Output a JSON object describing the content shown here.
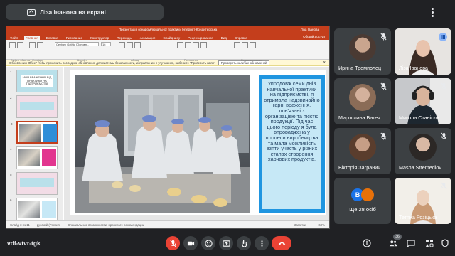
{
  "header": {
    "presenting_text": "Ліза Іванова на екрані"
  },
  "powerpoint": {
    "title": "Презентація ознайомлювальної практики Інтернет-Кондитерська",
    "user": "Ліза Іванова",
    "tabs": [
      "Файл",
      "Главная",
      "Вставка",
      "Рисование",
      "Конструктор",
      "Переходы",
      "Анимация",
      "Слайд-шоу",
      "Рецензирование",
      "Вид",
      "Справка"
    ],
    "active_tab": "Главная",
    "share_label": "Общий доступ",
    "font_name": "Century Gothic (Основн...",
    "font_size": "16",
    "ribbon_groups": [
      "Буфер обмена",
      "Слайды",
      "Шрифт",
      "Абзац",
      "Рисование",
      "Редактирование"
    ],
    "message_bar": "Обновления Office  Чтобы применить последние обновления для системы безопасности, исправления и улучшения, выберите \"Проверить наличие обновлений\".",
    "message_button": "Проверить наличие обновлений",
    "slide_numbers": [
      "1",
      "2",
      "3",
      "4",
      "5",
      "6"
    ],
    "thumb1_text": "МОЯ ВРАЖЕННЯ ВІД ПРАКТИКИ НА ПІДПРИЄМСТВІ",
    "slide_text": "Упродовж семи днів навчальної практики на підприємстві, я отримала надзвичайно гарні враження, пов'язані з організацією та якістю продукції. Під час цього періоду я була впроваджена у процеси виробництва та мала можливість взяти участь у різних етапах створення харчових продуктів.",
    "status_left": "Слайд 3 из 11",
    "status_lang": "русский (Россия)",
    "status_access": "Специальные возможности: проверьте рекомендации",
    "status_notes": "Заметки",
    "status_zoom": "69%"
  },
  "participants": [
    {
      "name": "Ирина Тремполец",
      "muted": true
    },
    {
      "name": "Ліза Іванова",
      "muted": false,
      "speaking": true
    },
    {
      "name": "Мирослава Батеч...",
      "muted": true
    },
    {
      "name": "Микола Станісла...",
      "muted": true
    },
    {
      "name": "Вікторія Загранич...",
      "muted": true
    },
    {
      "name": "Masha Stremedlov...",
      "muted": true
    },
    {
      "name": "Тетяна Розіцька",
      "muted": true
    }
  ],
  "more_tile": {
    "label": "Ще 28 осіб",
    "badge_letter": "B",
    "badge_color_1": "#1a73e8",
    "badge_color_2": "#e8710a"
  },
  "bottom": {
    "meeting_code": "vdf-vtvr-tgk",
    "participant_count": "36"
  },
  "colors": {
    "end_call": "#ea4335",
    "ppt_accent": "#c43e1c",
    "slide_textbox": "#1f95e0"
  }
}
